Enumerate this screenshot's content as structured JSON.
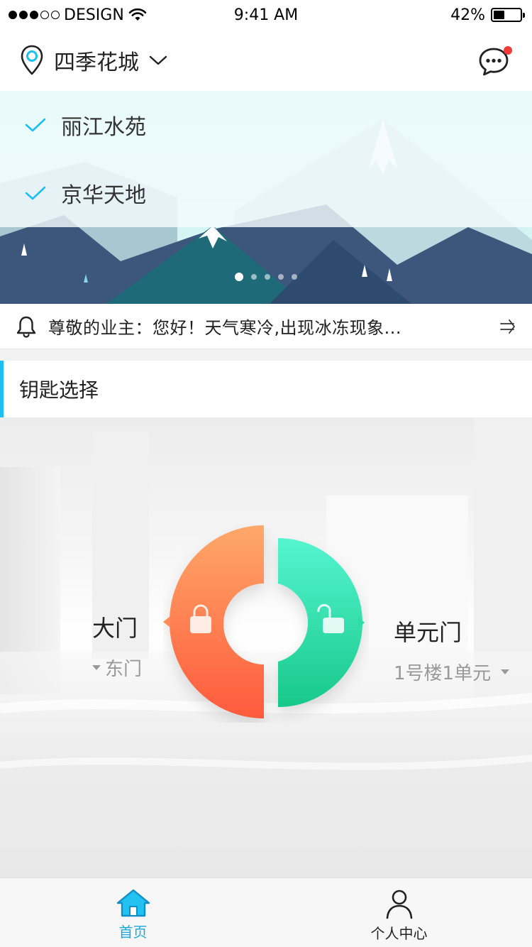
{
  "status_bar": {
    "carrier": "DESIGN",
    "time": "9:41 AM",
    "battery": "42%",
    "battery_level": 0.42,
    "signal_bars_filled": 3,
    "signal_bars_total": 5
  },
  "header": {
    "location": "四季花城",
    "location_icon": "map-pin-icon",
    "dropdown_icon": "chevron-down-icon",
    "message_icon": "chat-bubble-icon",
    "has_unread": true
  },
  "community_dropdown": {
    "items": [
      {
        "label": "丽江水苑"
      },
      {
        "label": "京华天地"
      }
    ],
    "check_icon": "check-icon"
  },
  "banner": {
    "slide_count": 5,
    "active_slide": 1
  },
  "notice": {
    "icon": "bell-icon",
    "text": "尊敬的业主：您好！天气寒冷,出现冰冻现象...",
    "arrow_icon": "arrow-right-icon"
  },
  "key_section": {
    "title": "钥匙选择",
    "left_gate": {
      "name": "大门",
      "sub": "东门"
    },
    "right_gate": {
      "name": "单元门",
      "sub": "1号楼1单元"
    }
  },
  "tabbar": {
    "tabs": [
      {
        "label": "首页",
        "icon": "home-icon",
        "active": true
      },
      {
        "label": "个人中心",
        "icon": "user-icon",
        "active": false
      }
    ]
  },
  "colors": {
    "accent": "#1dc0f0",
    "tab_active": "#1aa8e0",
    "orange_top": "#ffa869",
    "orange_bottom": "#ff5a3c",
    "green_top": "#55f5d0",
    "green_bottom": "#17c88a",
    "unread_dot": "#f23a3a"
  }
}
